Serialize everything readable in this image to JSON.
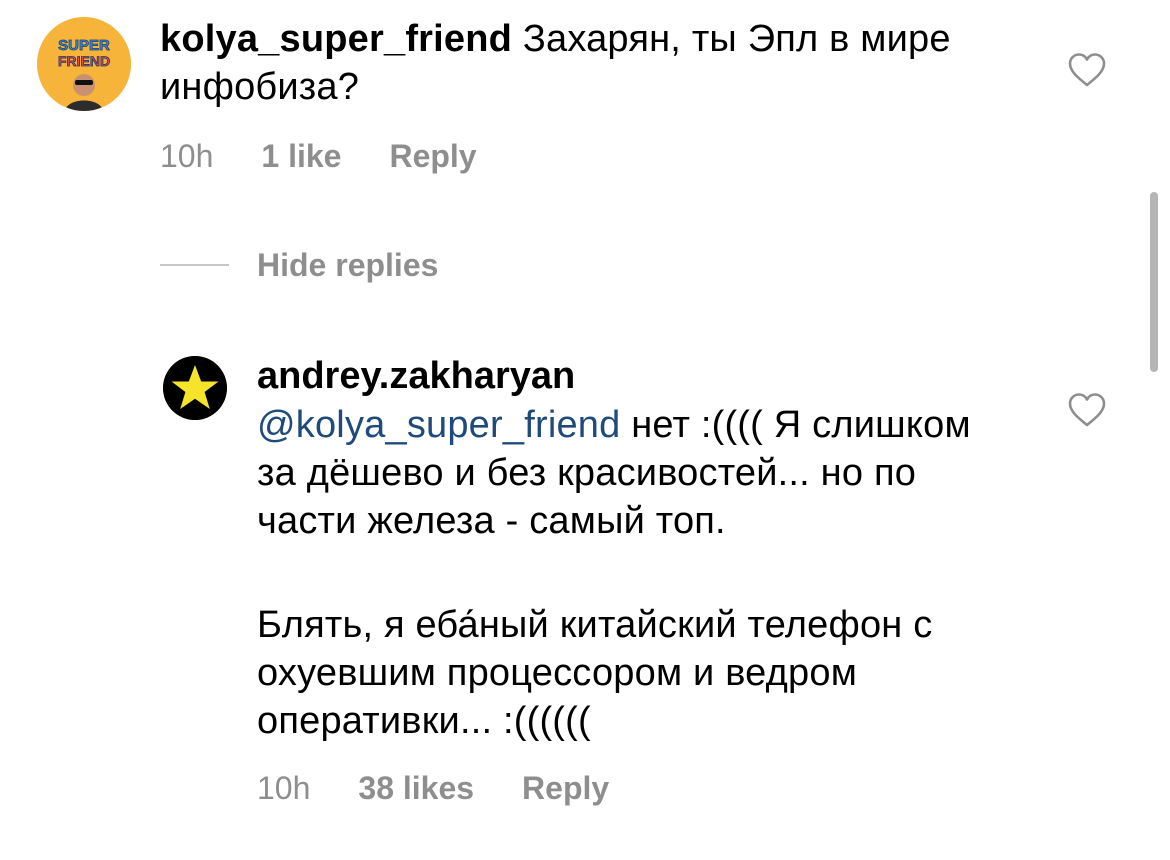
{
  "comment_1": {
    "username": "kolya_super_friend",
    "text": "Захарян, ты Эпл в мире инфобиза?",
    "time": "10h",
    "likes": "1 like",
    "reply_label": "Reply",
    "avatar_text_line1": "SUPER",
    "avatar_text_line2": "FRIEND"
  },
  "hide_replies_label": "Hide replies",
  "comment_2": {
    "username": "andrey.zakharyan",
    "mention": "@kolya_super_friend",
    "text_part1": " нет :(((( Я слишком за дёшево и без красивостей... но по части железа - самый топ.",
    "text_part2": "Блять, я еба́ный китайский телефон с охуевшим процессором и ведром оперативки... :((((((",
    "time": "10h",
    "likes": "38 likes",
    "reply_label": "Reply"
  },
  "colors": {
    "meta_gray": "#8e8e8e",
    "mention_blue": "#1f4b7c",
    "avatar1_bg": "#f7b43a",
    "avatar2_bg": "#000000",
    "star_yellow": "#f5e42a"
  },
  "icons": {
    "like": "heart-outline-icon",
    "star": "star-icon"
  }
}
